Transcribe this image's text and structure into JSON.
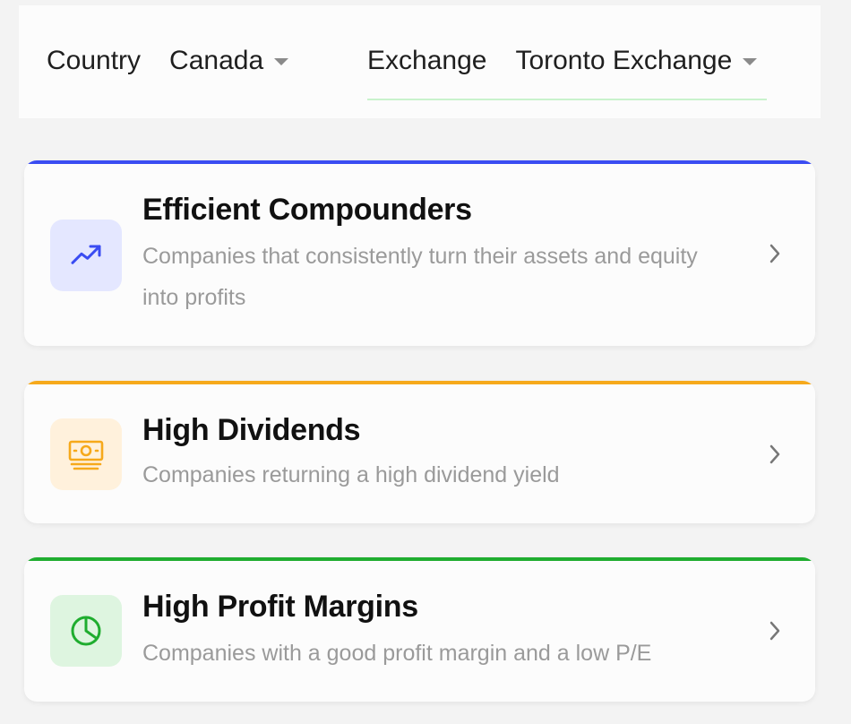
{
  "filters": {
    "country_label": "Country",
    "country_value": "Canada",
    "exchange_label": "Exchange",
    "exchange_value": "Toronto Exchange"
  },
  "cards": [
    {
      "title": "Efficient Compounders",
      "description": "Companies that consistently turn their assets and equity into profits",
      "accent": "#3a4cf2",
      "icon_bg": "#e4e7ff",
      "icon": "trending-up-icon"
    },
    {
      "title": "High Dividends",
      "description": "Companies returning a high dividend yield",
      "accent": "#f6a91b",
      "icon_bg": "#fff1dc",
      "icon": "cash-icon"
    },
    {
      "title": "High Profit Margins",
      "description": "Companies with a good profit margin and a low P/E",
      "accent": "#1fad2f",
      "icon_bg": "#def5e0",
      "icon": "pie-chart-icon"
    }
  ]
}
